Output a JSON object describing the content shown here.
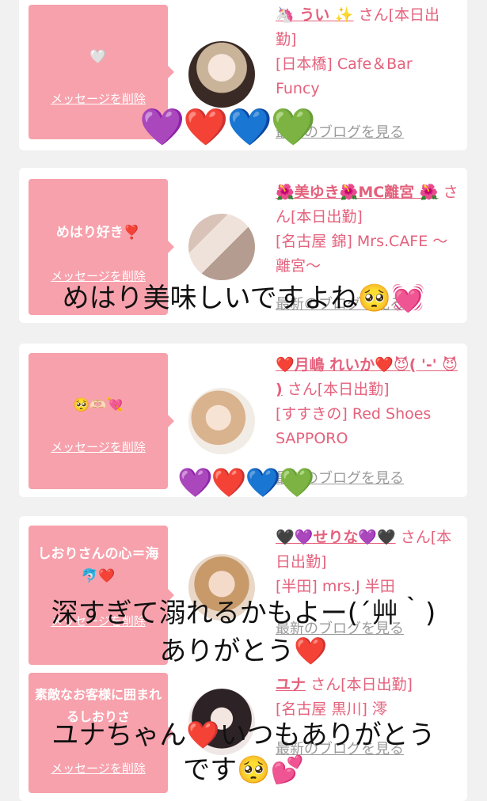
{
  "colors": {
    "page_bg": "#f1f1f1",
    "bubble": "#f7a1ac",
    "accent": "#e4617c",
    "link_gray": "#9a9a9a"
  },
  "cards": [
    {
      "message": "🤍",
      "delete_label": "メッセージを削除",
      "name": "🦄 うい ✨",
      "suffix": "さん[本日出勤]",
      "shop": "[日本橋] Cafe＆Bar Funcy",
      "blog": "最新のブログを見る"
    },
    {
      "message": "めはり好き❣️",
      "delete_label": "メッセージを削除",
      "name": "🌺美ゆき🌺MC離宮 🌺",
      "suffix": "さん[本日出勤]",
      "shop": "[名古屋 錦] Mrs.CAFE 〜離宮〜",
      "blog": "最新のブログを見る"
    },
    {
      "message": "🥺🫶🏻💘",
      "delete_label": "メッセージを削除",
      "name": "❤️月嶋 れいか❤️😈( '-' 😈 )",
      "suffix": "さん[本日出勤]",
      "shop": "[すすきの] Red Shoes SAPPORO",
      "blog": "最新のブログを見る"
    },
    {
      "message": "しおりさんの心＝海🐬❤️",
      "delete_label": "メッセージを削除",
      "name": "🖤💜せりな💜🖤",
      "suffix": "さん[本日出勤]",
      "shop": "[半田] mrs.J 半田",
      "blog": "最新のブログを見る"
    },
    {
      "message": "素敵なお客様に囲まれるしおりさ",
      "delete_label": "メッセージを削除",
      "name": "ユナ",
      "suffix": "さん[本日出勤]",
      "shop": "[名古屋 黒川] 澪",
      "blog": "最新のブログを見る"
    }
  ],
  "overlays": {
    "hearts1": "💜❤️💙💚",
    "text2": "めはり美味しいですよね🥺💓",
    "hearts3": "💜❤️💙💚",
    "text4a": "深すぎて溺れるかもよー(´艸｀)",
    "text4b": "ありがとう❤️",
    "text5a": "ユナちゃん❤️いつもありがとう",
    "text5b": "です🥺💕"
  }
}
